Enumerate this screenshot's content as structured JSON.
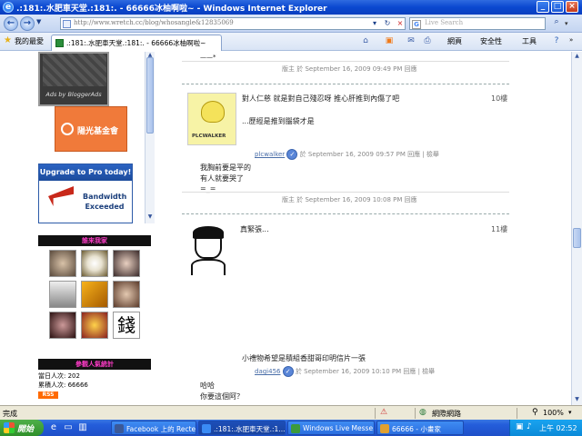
{
  "window": {
    "title": ".:181:.水肥車天堂.:181:. - 66666冰柚啊啦~ - Windows Internet Explorer",
    "minimize": "_",
    "maximize": "□",
    "close": "×"
  },
  "toolbar": {
    "back": "←",
    "forward": "→",
    "address": "http://www.wretch.cc/blog/whosangle&12835069",
    "refresh": "↻",
    "stop": "×",
    "search_placeholder": "Live Search",
    "search_go": "⌕"
  },
  "tabs": {
    "favorites_label": "我的最愛",
    "current_tab": ".:181:.水肥車天堂.:181:. - 66666冰柚啊啦~",
    "commands": [
      "網頁",
      "安全性",
      "工具"
    ]
  },
  "sidebar": {
    "ads_caption": "Ads by BloggerAds",
    "sun_foundation": "陽光基金會",
    "pro_header": "Upgrade to Pro today!",
    "bandwidth": "Bandwidth Exceeded",
    "visitors_title": "誰來我家",
    "popular_title": "參觀人氣統計",
    "today_label": "當日人次:",
    "today_value": "202",
    "total_label": "累積人次:",
    "total_value": "66666",
    "rss": "RSS"
  },
  "comments": [
    {
      "top_text": "——*",
      "reply_meta": "版主 於 September 16, 2009 09:49 PM 回應"
    },
    {
      "floor": "10樓",
      "text_line1": "對人仁慈 就是對自己殘忍呀 推心肝推到內傷了吧",
      "text_line2": "...歷經是推到腦袋才是",
      "user": "plcwalker",
      "meta": "於 September 16, 2009 09:57 PM 回應 | 檢舉",
      "reply_line1": "我胸前要是平的",
      "reply_line2": "有人就要哭了",
      "reply_line3": "=_=",
      "reply_meta": "版主 於 September 16, 2009 10:08 PM 回應"
    },
    {
      "floor": "11樓",
      "text_line1": "真緊張...",
      "text_bottom": "小禮物希望是積組香甜哥印明信片一張",
      "user": "dagi456",
      "meta": "於 September 16, 2009 10:10 PM 回應 | 檢舉",
      "reply_line1": "哈哈",
      "reply_line2": "你要這個阿？"
    }
  ],
  "statusbar": {
    "text": "完成",
    "zone": "網際網路",
    "zoom": "100%"
  },
  "taskbar": {
    "start": "開始",
    "tasks": [
      "Facebook 上的 Recte...",
      ".:181:.水肥車天堂.:1...",
      "Windows Live Messe...",
      "66666 - 小畫家"
    ],
    "time": "上午 02:52"
  },
  "colors": {
    "titlebar": "#0a48d0",
    "visitor_title_text": "#ff3bc8",
    "link": "#4a6ea8"
  }
}
